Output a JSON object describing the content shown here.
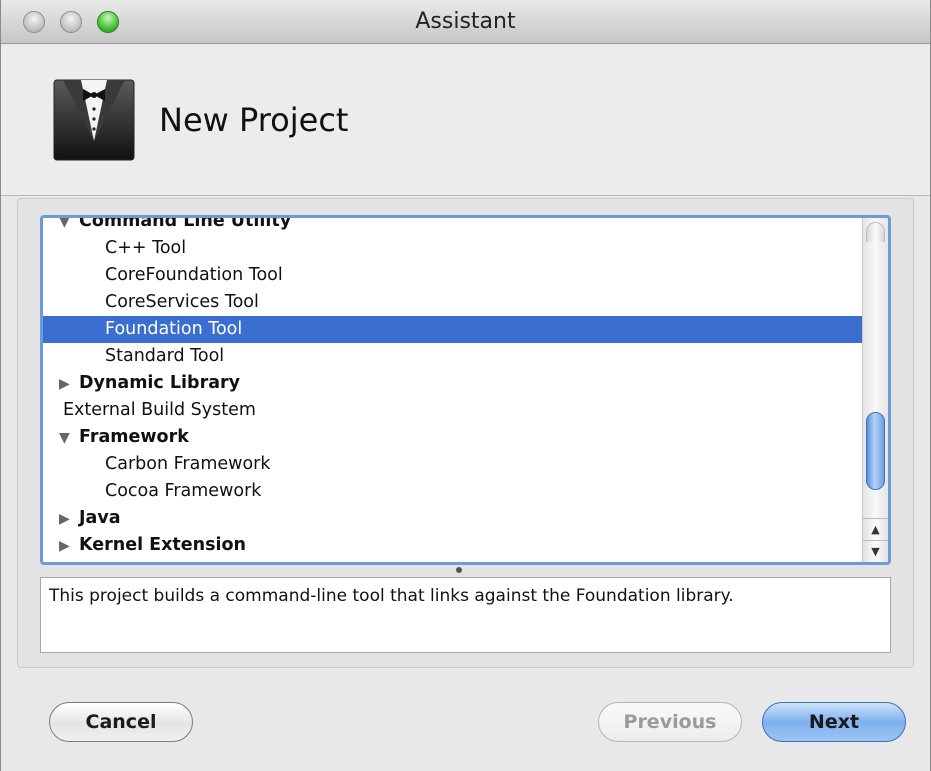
{
  "window": {
    "title": "Assistant"
  },
  "header": {
    "title": "New Project",
    "icon": "tuxedo-icon"
  },
  "list": {
    "items": [
      {
        "label": "Command Line Utility",
        "type": "group",
        "expanded": true
      },
      {
        "label": "C++ Tool",
        "type": "child"
      },
      {
        "label": "CoreFoundation Tool",
        "type": "child"
      },
      {
        "label": "CoreServices Tool",
        "type": "child"
      },
      {
        "label": "Foundation Tool",
        "type": "child",
        "selected": true
      },
      {
        "label": "Standard Tool",
        "type": "child"
      },
      {
        "label": "Dynamic Library",
        "type": "group",
        "expanded": false
      },
      {
        "label": "External Build System",
        "type": "leaf"
      },
      {
        "label": "Framework",
        "type": "group",
        "expanded": true
      },
      {
        "label": "Carbon Framework",
        "type": "child"
      },
      {
        "label": "Cocoa Framework",
        "type": "child"
      },
      {
        "label": "Java",
        "type": "group",
        "expanded": false
      },
      {
        "label": "Kernel Extension",
        "type": "group",
        "expanded": false
      }
    ],
    "expanded_glyph": "▼",
    "collapsed_glyph": "▶"
  },
  "scrollbar": {
    "up_glyph": "▲",
    "down_glyph": "▼"
  },
  "description": "This project builds a command-line tool that links against the Foundation library.",
  "buttons": {
    "cancel": "Cancel",
    "previous": "Previous",
    "next": "Next"
  },
  "colors": {
    "selection": "#3a6fd1",
    "focus_ring": "#6d9bd8",
    "default_button": "#7fb0ee"
  }
}
